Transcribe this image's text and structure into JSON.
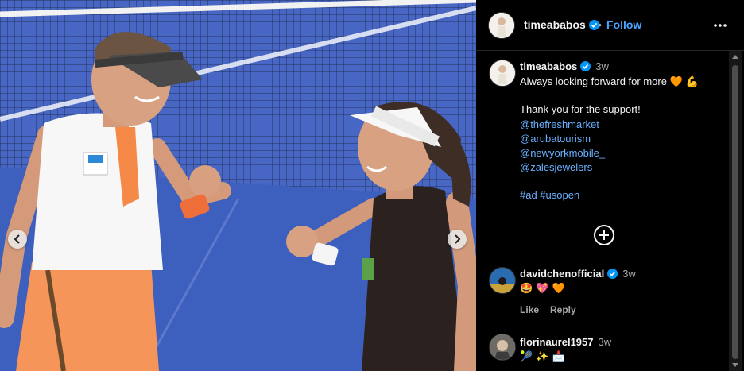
{
  "post": {
    "author": "timeababos",
    "follow_label": "Follow",
    "dot": "•"
  },
  "caption": {
    "username": "timeababos",
    "time": "3w",
    "line1": "Always looking forward for more",
    "line1_emojis": "🧡 💪",
    "line2": "Thank you for the support!",
    "mentions": [
      "@thefreshmarket",
      "@arubatourism",
      "@newyorkmobile_",
      "@zalesjewelers"
    ],
    "hashtags": "#ad #usopen"
  },
  "comments": [
    {
      "username": "davidchenofficial",
      "time": "3w",
      "text": "🤩 💖 🧡",
      "like_label": "Like",
      "reply_label": "Reply"
    },
    {
      "username": "florinaurel1957",
      "time": "3w",
      "text": "🎾 ✨ 📩"
    }
  ],
  "photo": {
    "shirt_logo_text": "NYMobile"
  },
  "colors": {
    "link": "#4aa3ff",
    "verified": "#0095f6",
    "court": "#3f63c6"
  },
  "icons": [
    "verified-badge-icon",
    "more-options-icon",
    "chevron-left-icon",
    "chevron-right-icon",
    "add-comment-icon"
  ]
}
